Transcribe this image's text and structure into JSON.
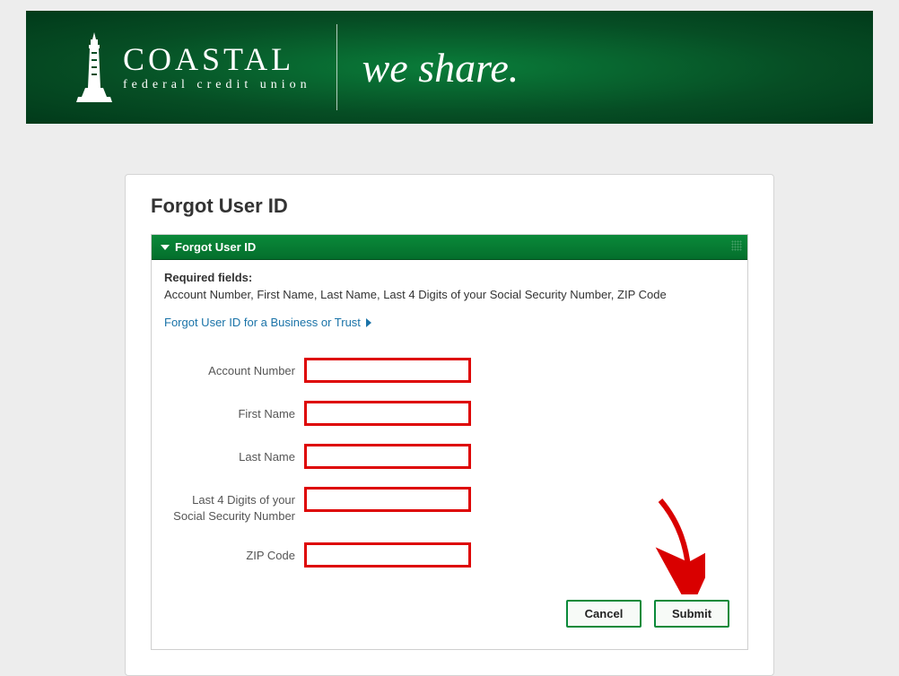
{
  "header": {
    "brand_main": "COASTAL",
    "brand_sub": "federal credit union",
    "tagline": "we share."
  },
  "page": {
    "title": "Forgot User ID",
    "panel_title": "Forgot User ID",
    "required_label": "Required fields:",
    "required_text": "Account Number, First Name, Last Name, Last 4 Digits of your Social Security Number, ZIP Code",
    "business_link": "Forgot User ID for a Business or Trust"
  },
  "form": {
    "fields": {
      "account_number": {
        "label": "Account Number",
        "value": ""
      },
      "first_name": {
        "label": "First Name",
        "value": ""
      },
      "last_name": {
        "label": "Last Name",
        "value": ""
      },
      "ssn4": {
        "label": "Last 4 Digits of your Social Security Number",
        "value": ""
      },
      "zip": {
        "label": "ZIP Code",
        "value": ""
      }
    }
  },
  "buttons": {
    "cancel": "Cancel",
    "submit": "Submit"
  }
}
